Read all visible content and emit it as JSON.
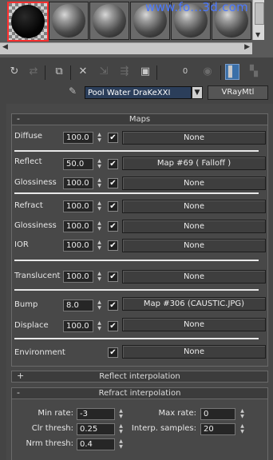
{
  "watermark": "www.fo...3d.com",
  "toolbar": {
    "icons": [
      "get-material-icon",
      "put-to-scene-icon",
      "assign-to-selection-icon",
      "reset-icon",
      "copy-icon",
      "make-unique-icon",
      "put-to-library-icon",
      "material-id-icon",
      "show-map-icon",
      "show-end-result-icon",
      "go-to-parent-icon"
    ],
    "mat_id_label": "0"
  },
  "material": {
    "name": "Pool Water DraKeXXI",
    "type_button": "VRayMtl"
  },
  "maps_rollout": {
    "sign": "-",
    "title": "Maps",
    "rows": [
      {
        "label": "Diffuse",
        "value": "100.0",
        "checked": true,
        "map": "None"
      },
      {
        "label": "Reflect",
        "value": "50.0",
        "checked": true,
        "map": "Map #69  ( Falloff )"
      },
      {
        "label": "Glossiness",
        "value": "100.0",
        "checked": true,
        "map": "None"
      },
      {
        "label": "Refract",
        "value": "100.0",
        "checked": true,
        "map": "None"
      },
      {
        "label": "Glossiness",
        "value": "100.0",
        "checked": true,
        "map": "None"
      },
      {
        "label": "IOR",
        "value": "100.0",
        "checked": true,
        "map": "None"
      },
      {
        "label": "Translucent",
        "value": "100.0",
        "checked": true,
        "map": "None"
      },
      {
        "label": "Bump",
        "value": "8.0",
        "checked": true,
        "map": "Map #306 (CAUSTIC.JPG)"
      },
      {
        "label": "Displace",
        "value": "100.0",
        "checked": true,
        "map": "None"
      },
      {
        "label": "Environment",
        "value": "",
        "checked": true,
        "map": "None"
      }
    ]
  },
  "reflect_interp": {
    "sign": "+",
    "title": "Reflect interpolation"
  },
  "refract_interp": {
    "sign": "-",
    "title": "Refract interpolation",
    "min_rate_label": "Min rate:",
    "min_rate": "-3",
    "max_rate_label": "Max rate:",
    "max_rate": "0",
    "clr_thresh_label": "Clr thresh:",
    "clr_thresh": "0.25",
    "interp_samples_label": "Interp. samples:",
    "interp_samples": "20",
    "nrm_thresh_label": "Nrm thresh:",
    "nrm_thresh": "0.4"
  },
  "check_mark": "✔",
  "colors": {
    "name_field_bg": "#2b3e5a",
    "active_slot_border": "#ff3030",
    "watermark": "#4a78ff"
  }
}
